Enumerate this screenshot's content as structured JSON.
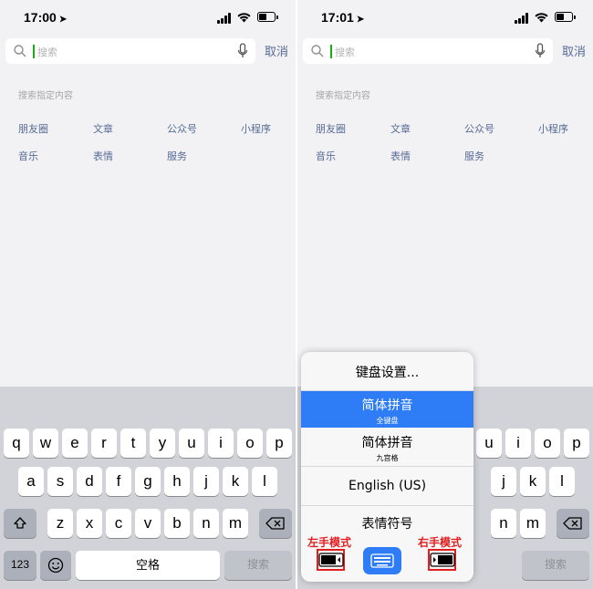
{
  "screens": [
    {
      "time": "17:00",
      "search_placeholder": "搜索",
      "cancel": "取消",
      "hint": "搜索指定内容",
      "categories": [
        "朋友圈",
        "文章",
        "公众号",
        "小程序",
        "音乐",
        "表情",
        "服务"
      ]
    },
    {
      "time": "17:01",
      "search_placeholder": "搜索",
      "cancel": "取消",
      "hint": "搜索指定内容",
      "categories": [
        "朋友圈",
        "文章",
        "公众号",
        "小程序",
        "音乐",
        "表情",
        "服务"
      ]
    }
  ],
  "keyboard": {
    "row1": [
      "q",
      "w",
      "e",
      "r",
      "t",
      "y",
      "u",
      "i",
      "o",
      "p"
    ],
    "row2": [
      "a",
      "s",
      "d",
      "f",
      "g",
      "h",
      "j",
      "k",
      "l"
    ],
    "row3": [
      "z",
      "x",
      "c",
      "v",
      "b",
      "n",
      "m"
    ],
    "num_key": "123",
    "space": "空格",
    "search": "搜索"
  },
  "keyboard_menu": {
    "settings": "键盘设置...",
    "items": [
      {
        "title": "简体拼音",
        "subtitle": "全键盘",
        "selected": true
      },
      {
        "title": "简体拼音",
        "subtitle": "九宫格",
        "selected": false
      },
      {
        "title": "English (US)",
        "subtitle": "",
        "selected": false
      },
      {
        "title": "表情符号",
        "subtitle": "",
        "selected": false
      }
    ],
    "left_mode_label": "左手模式",
    "right_mode_label": "右手模式"
  },
  "colors": {
    "link": "#576b95",
    "accent_blue": "#2e7cf6",
    "annotation_red": "#e02020",
    "cursor_green": "#1aad19"
  }
}
